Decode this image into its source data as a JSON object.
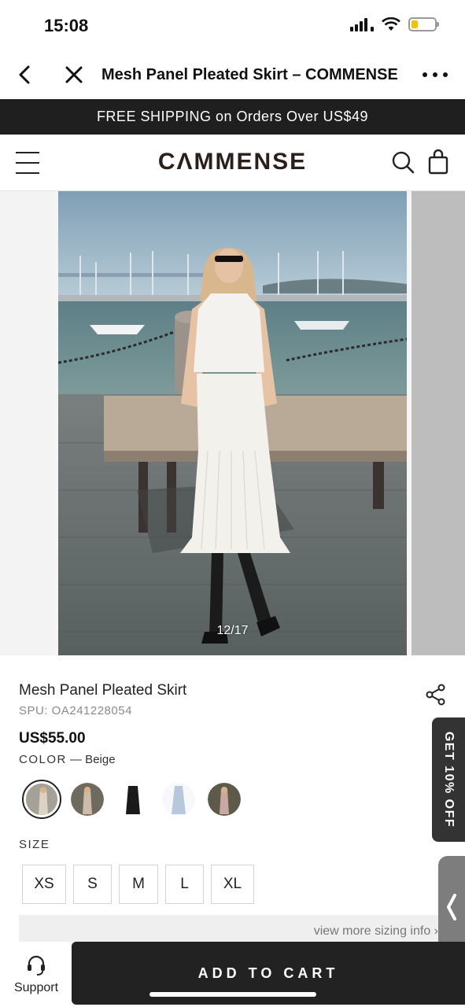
{
  "status_bar": {
    "time": "15:08"
  },
  "browser": {
    "title": "Mesh Panel Pleated Skirt – COMMENSE"
  },
  "promo": {
    "text": "FREE SHIPPING on Orders Over US$49"
  },
  "site": {
    "logo": "CɅMMENSE"
  },
  "gallery": {
    "counter": "12/17"
  },
  "product": {
    "name": "Mesh Panel Pleated Skirt",
    "spu": "SPU: OA241228054",
    "price": "US$55.00",
    "color_label": "COLOR",
    "color_value": "— Beige",
    "swatches": [
      {
        "name": "Beige",
        "color": "#d9d0c2",
        "selected": true
      },
      {
        "name": "Beige alt",
        "color": "#c8b9a6",
        "selected": false
      },
      {
        "name": "Black",
        "color": "#1a1a1a",
        "selected": false
      },
      {
        "name": "Light Blue",
        "color": "#b8c8dc",
        "selected": false
      },
      {
        "name": "Pink",
        "color": "#c9a7a3",
        "selected": false
      }
    ],
    "size_label": "SIZE",
    "sizes": [
      "XS",
      "S",
      "M",
      "L",
      "XL"
    ],
    "sizing_info": "view more sizing info"
  },
  "floating": {
    "discount": "GET 10% OFF"
  },
  "bottom": {
    "support_label": "Support",
    "add_to_cart": "ADD TO CART"
  }
}
